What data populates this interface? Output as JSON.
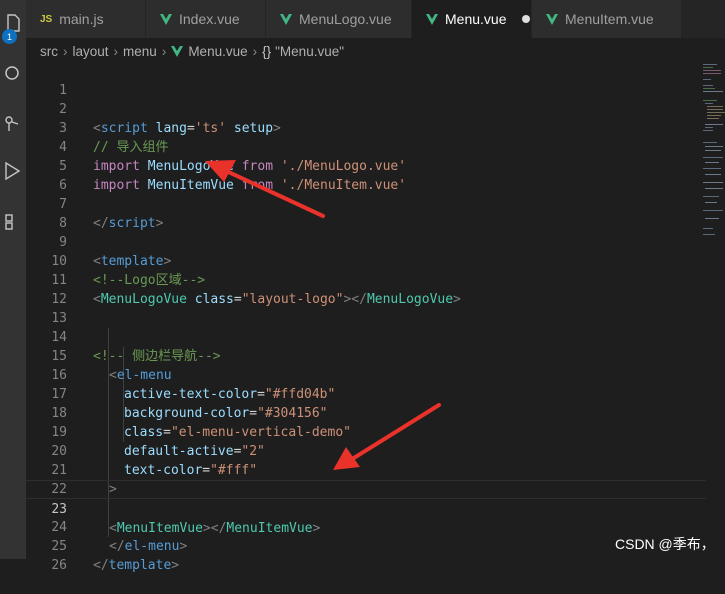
{
  "tabs": [
    {
      "label": "main.js",
      "icon": "js-icon",
      "active": false
    },
    {
      "label": "Index.vue",
      "icon": "vue-icon",
      "active": false
    },
    {
      "label": "MenuLogo.vue",
      "icon": "vue-icon",
      "active": false
    },
    {
      "label": "Menu.vue",
      "icon": "vue-icon",
      "active": true,
      "modified": true
    },
    {
      "label": "MenuItem.vue",
      "icon": "vue-icon",
      "active": false
    }
  ],
  "activity_bar": {
    "badge": "1",
    "icons": [
      "explorer-icon",
      "search-icon",
      "source-control-icon",
      "run-debug-icon",
      "extensions-icon"
    ]
  },
  "breadcrumb": {
    "items": [
      "src",
      "layout",
      "menu",
      "Menu.vue",
      "\"Menu.vue\""
    ],
    "file_label": "Menu.vue",
    "symbol_label": "\"Menu.vue\""
  },
  "editor": {
    "current_line": 23,
    "line_numbers": [
      "1",
      "2",
      "3",
      "4",
      "5",
      "6",
      "7",
      "8",
      "9",
      "10",
      "11",
      "12",
      "13",
      "14",
      "15",
      "16",
      "17",
      "18",
      "19",
      "20",
      "21",
      "22",
      "23",
      "24",
      "25",
      "26"
    ],
    "lines": {
      "l2": {
        "t1": "<",
        "t2": "script",
        "t3": " lang",
        "t4": "=",
        "t5": "'ts'",
        "t6": " setup",
        "t7": ">"
      },
      "l3": "// 导入组件",
      "l4": {
        "kw": "import",
        "id": " MenuLogoVue",
        "from": " from",
        "src": " './MenuLogo.vue'"
      },
      "l5": {
        "kw": "import",
        "id": " MenuItemVue",
        "from": " from",
        "src": " './MenuItem.vue'"
      },
      "l7": {
        "open": "</",
        "tag": "script",
        "close": ">"
      },
      "l9": {
        "open": "<",
        "tag": "template",
        "close": ">"
      },
      "l10": "<!--Logo区域-->",
      "l11": {
        "o": "<",
        "tag": "MenuLogoVue",
        "attr": " class",
        "eq": "=",
        "val": "\"layout-logo\"",
        "c1": "></",
        "tag2": "MenuLogoVue",
        "c2": ">"
      },
      "l14": "<!-- 侧边栏导航-->",
      "l15": {
        "open": "<",
        "tag": "el-menu"
      },
      "l16": {
        "attr": "active-text-color",
        "eq": "=",
        "val": "\"#ffd04b\""
      },
      "l17": {
        "attr": "background-color",
        "eq": "=",
        "val": "\"#304156\""
      },
      "l18": {
        "attr": "class",
        "eq": "=",
        "val": "\"el-menu-vertical-demo\""
      },
      "l19": {
        "attr": "default-active",
        "eq": "=",
        "val": "\"2\""
      },
      "l20": {
        "attr": "text-color",
        "eq": "=",
        "val": "\"#fff\""
      },
      "l21": ">",
      "l23": {
        "o": "<",
        "tag": "MenuItemVue",
        "c1": "></",
        "tag2": "MenuItemVue",
        "c2": ">"
      },
      "l24": {
        "open": "</",
        "tag": "el-menu",
        "close": ">"
      },
      "l25": {
        "open": "</",
        "tag": "template",
        "close": ">"
      }
    }
  },
  "watermark": "CSDN @季布，",
  "colors": {
    "background": "#1e1e1e",
    "tab_bar": "#252526",
    "activity_bar": "#333333",
    "comment": "#6a9955",
    "tag": "#569cd6",
    "attribute": "#9cdcfe",
    "string": "#ce9178",
    "keyword": "#c586c0",
    "arrow": "#e8322a",
    "vue_green": "#41b883"
  }
}
